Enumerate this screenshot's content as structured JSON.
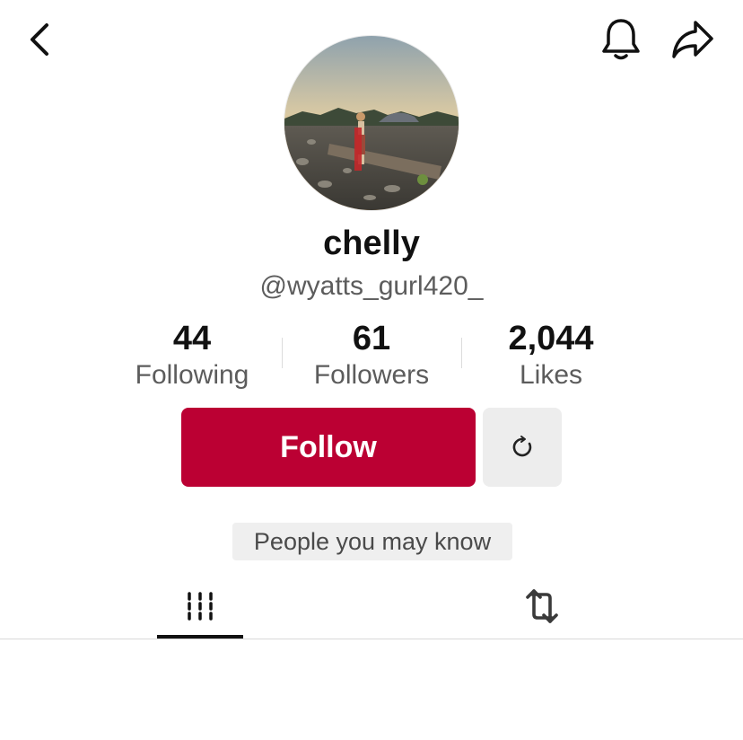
{
  "profile": {
    "display_name": "chelly",
    "handle": "@wyatts_gurl420_"
  },
  "stats": [
    {
      "value": "44",
      "label": "Following"
    },
    {
      "value": "61",
      "label": "Followers"
    },
    {
      "value": "2,044",
      "label": "Likes"
    }
  ],
  "actions": {
    "follow_label": "Follow",
    "suggestions_icon": "refresh-circle-icon"
  },
  "people_you_may_know": "People you may know",
  "tabs": [
    {
      "icon": "videos-grid-icon",
      "selected": true
    },
    {
      "icon": "reposts-icon",
      "selected": false
    }
  ],
  "header_icons": [
    "back-chevron-icon",
    "bell-icon",
    "share-arrow-icon"
  ],
  "colors": {
    "follow_button": "#bb0033",
    "secondary_button": "#ededed",
    "text_primary": "#111111",
    "text_secondary": "#5c5c5c"
  }
}
